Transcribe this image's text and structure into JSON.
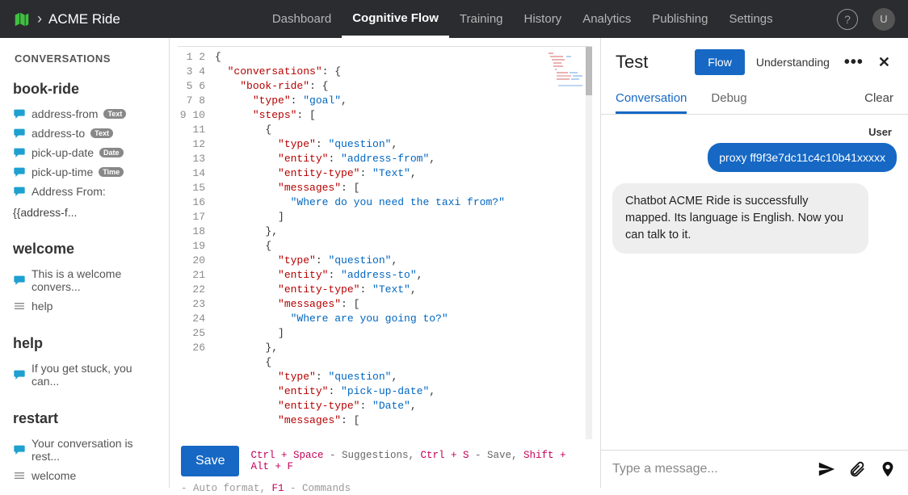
{
  "header": {
    "brand": "ACME Ride",
    "nav": [
      "Dashboard",
      "Cognitive Flow",
      "Training",
      "History",
      "Analytics",
      "Publishing",
      "Settings"
    ],
    "nav_active": 1,
    "help_glyph": "?",
    "avatar_letter": "U"
  },
  "sidebar": {
    "header": "CONVERSATIONS",
    "groups": [
      {
        "title": "book-ride",
        "items": [
          {
            "icon": "chat",
            "label": "address-from",
            "badge": "Text"
          },
          {
            "icon": "chat",
            "label": "address-to",
            "badge": "Text"
          },
          {
            "icon": "chat",
            "label": "pick-up-date",
            "badge": "Date"
          },
          {
            "icon": "chat",
            "label": "pick-up-time",
            "badge": "Time"
          },
          {
            "icon": "chat",
            "label": "Address From:"
          }
        ],
        "tail": "{{address-f..."
      },
      {
        "title": "welcome",
        "items": [
          {
            "icon": "chat",
            "label": "This is a welcome convers..."
          },
          {
            "icon": "list",
            "label": "help"
          }
        ]
      },
      {
        "title": "help",
        "items": [
          {
            "icon": "chat",
            "label": "If you get stuck, you can..."
          }
        ]
      },
      {
        "title": "restart",
        "items": [
          {
            "icon": "chat",
            "label": "Your conversation is rest..."
          },
          {
            "icon": "list",
            "label": "welcome"
          }
        ]
      }
    ]
  },
  "editor": {
    "lines": [
      "{",
      "  \"conversations\": {",
      "    \"book-ride\": {",
      "      \"type\": \"goal\",",
      "      \"steps\": [",
      "        {",
      "          \"type\": \"question\",",
      "          \"entity\": \"address-from\",",
      "          \"entity-type\": \"Text\",",
      "          \"messages\": [",
      "            \"Where do you need the taxi from?\"",
      "          ]",
      "        },",
      "        {",
      "          \"type\": \"question\",",
      "          \"entity\": \"address-to\",",
      "          \"entity-type\": \"Text\",",
      "          \"messages\": [",
      "            \"Where are you going to?\"",
      "          ]",
      "        },",
      "        {",
      "          \"type\": \"question\",",
      "          \"entity\": \"pick-up-date\",",
      "          \"entity-type\": \"Date\",",
      "          \"messages\": ["
    ],
    "line_start": 1,
    "save": "Save",
    "hints": {
      "suggest_key": "Ctrl + Space",
      "suggest_txt": " - Suggestions, ",
      "save_key": "Ctrl + S",
      "save_txt": " - Save, ",
      "fmt_key": "Shift + Alt + F",
      "fmt2": " - Auto format, ",
      "cmd_key": "F1",
      "cmd_txt": " - Commands"
    }
  },
  "test": {
    "title": "Test",
    "modes": {
      "flow": "Flow",
      "understanding": "Understanding"
    },
    "tabs": {
      "conversation": "Conversation",
      "debug": "Debug",
      "clear": "Clear"
    },
    "user_label": "User",
    "user_msg": "proxy ff9f3e7dc11c4c10b41xxxxx",
    "bot_msg": "Chatbot ACME Ride is successfully mapped. Its language is English. Now you can talk to it.",
    "placeholder": "Type a message..."
  }
}
